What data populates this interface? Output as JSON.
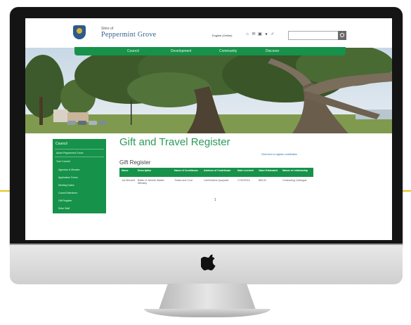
{
  "colors": {
    "accent_green": "#16924a",
    "title_green": "#2b9a58",
    "accent_yellow": "#e9c21a"
  },
  "site": {
    "logo_small": "Shire of",
    "logo_name": "Peppermint Grove",
    "utility_link": "English (Online)",
    "utility_icons": [
      "home-icon",
      "mail-icon",
      "share-icon",
      "share-alt-icon",
      "user-icon"
    ],
    "search_icon": "search-icon",
    "nav": [
      "Council",
      "Development",
      "Community",
      "Discover"
    ]
  },
  "sidebar": {
    "heading": "Council",
    "items": [
      {
        "label": "About Peppermint Grove",
        "top": true
      },
      {
        "label": "Your Council",
        "top": true
      },
      {
        "label": "Agendas & Minutes",
        "top": false
      },
      {
        "label": "Application Forms",
        "top": false
      },
      {
        "label": "Meeting Dates",
        "top": false
      },
      {
        "label": "Council Members",
        "top": false
      },
      {
        "label": "Gift Register",
        "top": false
      },
      {
        "label": "Shire Staff",
        "top": false
      }
    ]
  },
  "page": {
    "title": "Gift and Travel Register",
    "subtitle": "Gift Register",
    "top_link": "Click here to register contribution"
  },
  "table": {
    "headers": [
      "Name",
      "Description",
      "Name of Contributor",
      "Address of Contributor",
      "Date received",
      "Value Estimated",
      "Nature of relationship"
    ],
    "rows": [
      [
        "Joe Bennett",
        "Bottle of Johnnie Walker Whiskey",
        "Tristan and Cont",
        "Lidl Brothers Quayside",
        "17/02/2016",
        "$60.00",
        "Contracting Colleague"
      ]
    ],
    "pager": "1"
  },
  "monitor": {
    "logo_icon": "apple-logo-icon"
  }
}
